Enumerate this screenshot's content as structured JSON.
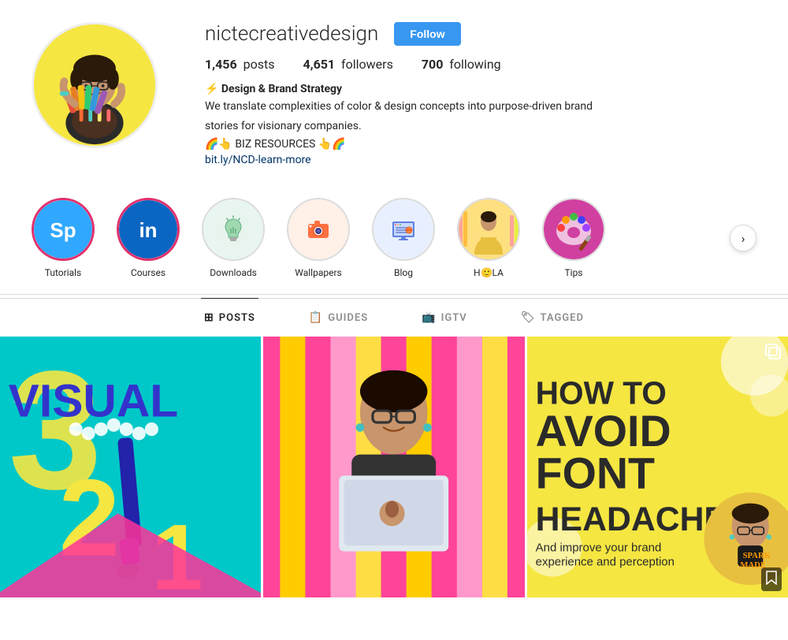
{
  "profile": {
    "username": "nictecreativedesign",
    "follow_label": "Follow",
    "stats": {
      "posts_count": "1,456",
      "posts_label": "posts",
      "followers_count": "4,651",
      "followers_label": "followers",
      "following_count": "700",
      "following_label": "following"
    },
    "bio": {
      "name": "⚡ Design & Brand Strategy",
      "line1": "We translate complexities of color & design concepts into purpose-driven brand",
      "line2": "stories for visionary companies.",
      "biz_line": "🌈👆 BIZ RESOURCES 👆🌈",
      "link": "bit.ly/NCD-learn-more"
    }
  },
  "stories": [
    {
      "id": "tutorials",
      "label": "Tutorials",
      "type": "sp",
      "border": "pink"
    },
    {
      "id": "courses",
      "label": "Courses",
      "type": "linkedin",
      "border": "pink"
    },
    {
      "id": "downloads",
      "label": "Downloads",
      "type": "lightbulb",
      "border": "plain"
    },
    {
      "id": "wallpapers",
      "label": "Wallpapers",
      "type": "camera",
      "border": "plain"
    },
    {
      "id": "blog",
      "label": "Blog",
      "type": "monitor",
      "border": "plain"
    },
    {
      "id": "hola",
      "label": "HOLA",
      "type": "person",
      "border": "plain"
    },
    {
      "id": "tips",
      "label": "Tips",
      "type": "palette",
      "border": "plain"
    }
  ],
  "tabs": [
    {
      "id": "posts",
      "label": "POSTS",
      "icon": "grid",
      "active": true
    },
    {
      "id": "guides",
      "label": "GUIDES",
      "icon": "book",
      "active": false
    },
    {
      "id": "igtv",
      "label": "IGTV",
      "icon": "tv",
      "active": false
    },
    {
      "id": "tagged",
      "label": "TAGGED",
      "icon": "tag",
      "active": false
    }
  ],
  "posts": [
    {
      "id": "post1",
      "alt": "Visual 321 design graphic"
    },
    {
      "id": "post2",
      "alt": "Person holding laptop"
    },
    {
      "id": "post3",
      "alt": "How to avoid font headaches"
    }
  ]
}
